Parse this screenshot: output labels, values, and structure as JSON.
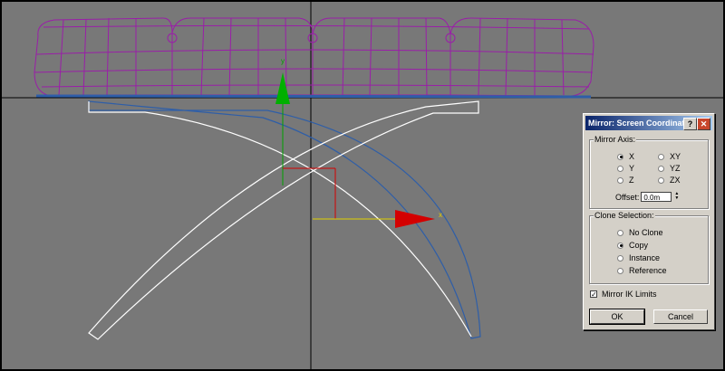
{
  "viewport": {
    "background": "#787878",
    "gizmo_x_label": "x",
    "gizmo_y_label": "y",
    "colors": {
      "wireframe": "#9a1ea8",
      "frame": "#ffffff",
      "frame_edge": "#2e5ea8",
      "x_axis": "#d40000",
      "y_axis": "#00a000"
    }
  },
  "dialog": {
    "title": "Mirror: Screen Coordinates",
    "help_icon": "?",
    "close_icon": "close-icon",
    "mirror_axis": {
      "label": "Mirror Axis:",
      "options": [
        "X",
        "Y",
        "Z",
        "XY",
        "YZ",
        "ZX"
      ],
      "selected": "X",
      "offset_label": "Offset:",
      "offset_value": "0.0m"
    },
    "clone_selection": {
      "label": "Clone Selection:",
      "options": [
        "No Clone",
        "Copy",
        "Instance",
        "Reference"
      ],
      "selected": "Copy"
    },
    "mirror_ik": {
      "label": "Mirror IK Limits",
      "checked": true,
      "mark": "✓"
    },
    "ok_label": "OK",
    "cancel_label": "Cancel"
  }
}
